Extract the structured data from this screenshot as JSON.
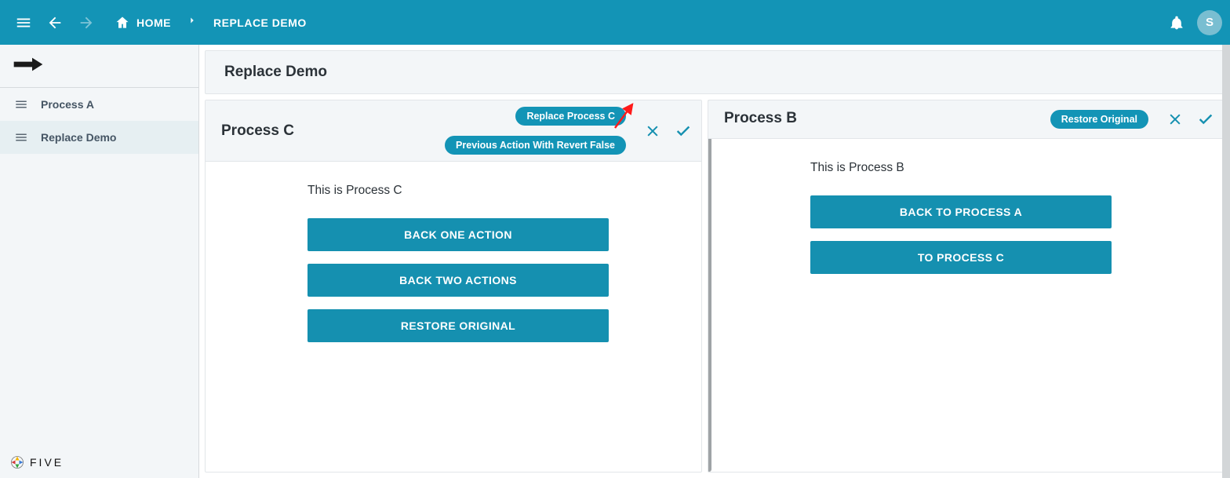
{
  "colors": {
    "brand": "#1394b6",
    "brandDark": "#0d84aa"
  },
  "appbar": {
    "home_label": "HOME",
    "current_label": "REPLACE DEMO",
    "avatar_initial": "S"
  },
  "sidebar": {
    "items": [
      {
        "label": "Process A"
      },
      {
        "label": "Replace Demo"
      }
    ],
    "footer_brand": "FIVE"
  },
  "page": {
    "title": "Replace Demo"
  },
  "left_card": {
    "title": "Process C",
    "chip_top": "Replace Process C",
    "chip_bottom": "Previous Action With Revert False",
    "body_text": "This is Process C",
    "buttons": [
      "BACK ONE ACTION",
      "BACK TWO ACTIONS",
      "RESTORE ORIGINAL"
    ]
  },
  "right_card": {
    "title": "Process B",
    "chip": "Restore Original",
    "body_text": "This is Process B",
    "buttons": [
      "BACK TO PROCESS A",
      "TO PROCESS C"
    ]
  }
}
